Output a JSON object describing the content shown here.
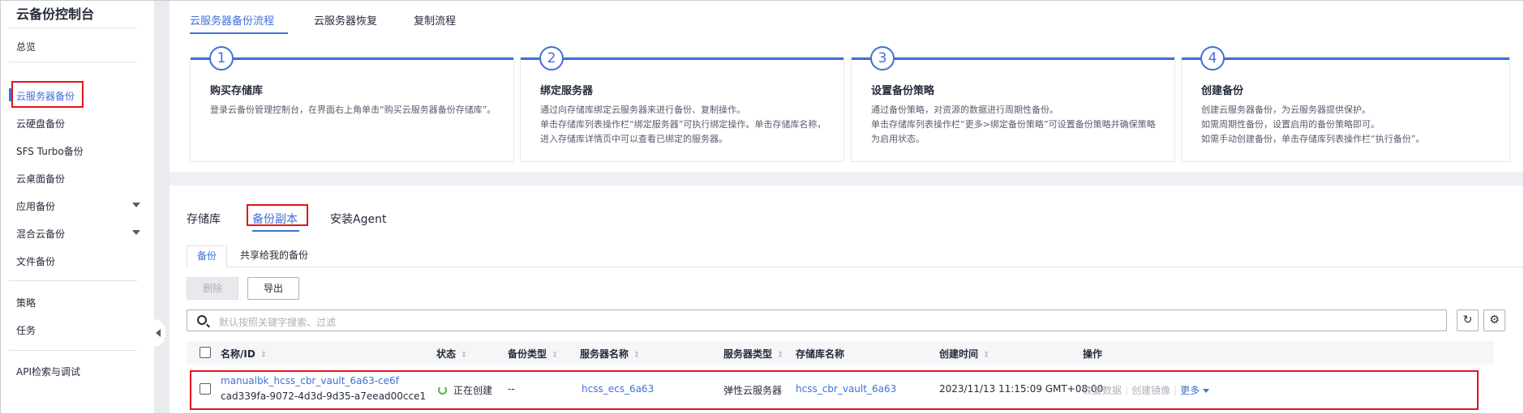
{
  "sidebar": {
    "title": "云备份控制台",
    "items": [
      {
        "label": "总览"
      },
      {
        "label": "云服务器备份"
      },
      {
        "label": "云硬盘备份"
      },
      {
        "label": "SFS Turbo备份"
      },
      {
        "label": "云桌面备份"
      },
      {
        "label": "应用备份"
      },
      {
        "label": "混合云备份"
      },
      {
        "label": "文件备份"
      },
      {
        "label": "策略"
      },
      {
        "label": "任务"
      },
      {
        "label": "API检索与调试"
      }
    ]
  },
  "top_tabs": [
    "云服务器备份流程",
    "云服务器恢复",
    "复制流程"
  ],
  "steps": [
    {
      "num": "1",
      "title": "购买存储库",
      "desc": "登录云备份管理控制台，在界面右上角单击“购买云服务器备份存储库”。"
    },
    {
      "num": "2",
      "title": "绑定服务器",
      "desc": "通过向存储库绑定云服务器来进行备份、复制操作。\n单击存储库列表操作栏“绑定服务器”可执行绑定操作。单击存储库名称，进入存储库详情页中可以查看已绑定的服务器。"
    },
    {
      "num": "3",
      "title": "设置备份策略",
      "desc": "通过备份策略，对资源的数据进行周期性备份。\n单击存储库列表操作栏“更多>绑定备份策略”可设置备份策略并确保策略为启用状态。"
    },
    {
      "num": "4",
      "title": "创建备份",
      "desc": "创建云服务器备份，为云服务器提供保护。\n如需周期性备份，设置启用的备份策略即可。\n如需手动创建备份，单击存储库列表操作栏“执行备份”。"
    }
  ],
  "sub_tabs": [
    "存储库",
    "备份副本",
    "安装Agent"
  ],
  "inner_tabs": [
    "备份",
    "共享给我的备份"
  ],
  "toolbar": {
    "delete_label": "删除",
    "export_label": "导出"
  },
  "search": {
    "placeholder": "默认按照关键字搜索、过滤"
  },
  "table": {
    "columns": [
      "名称/ID",
      "状态",
      "备份类型",
      "服务器名称",
      "服务器类型",
      "存储库名称",
      "创建时间",
      "操作"
    ],
    "rows": [
      {
        "name": "manualbk_hcss_cbr_vault_6a63-ce6f",
        "id": "cad339fa-9072-4d3d-9d35-a7eead00cce1",
        "status": "正在创建",
        "backup_type": "--",
        "server_name": "hcss_ecs_6a63",
        "server_type": "弹性云服务器",
        "vault_name": "hcss_cbr_vault_6a63",
        "created": "2023/11/13 11:15:09 GMT+08:00",
        "actions": [
          "恢复数据",
          "创建镜像",
          "更多"
        ]
      }
    ]
  }
}
